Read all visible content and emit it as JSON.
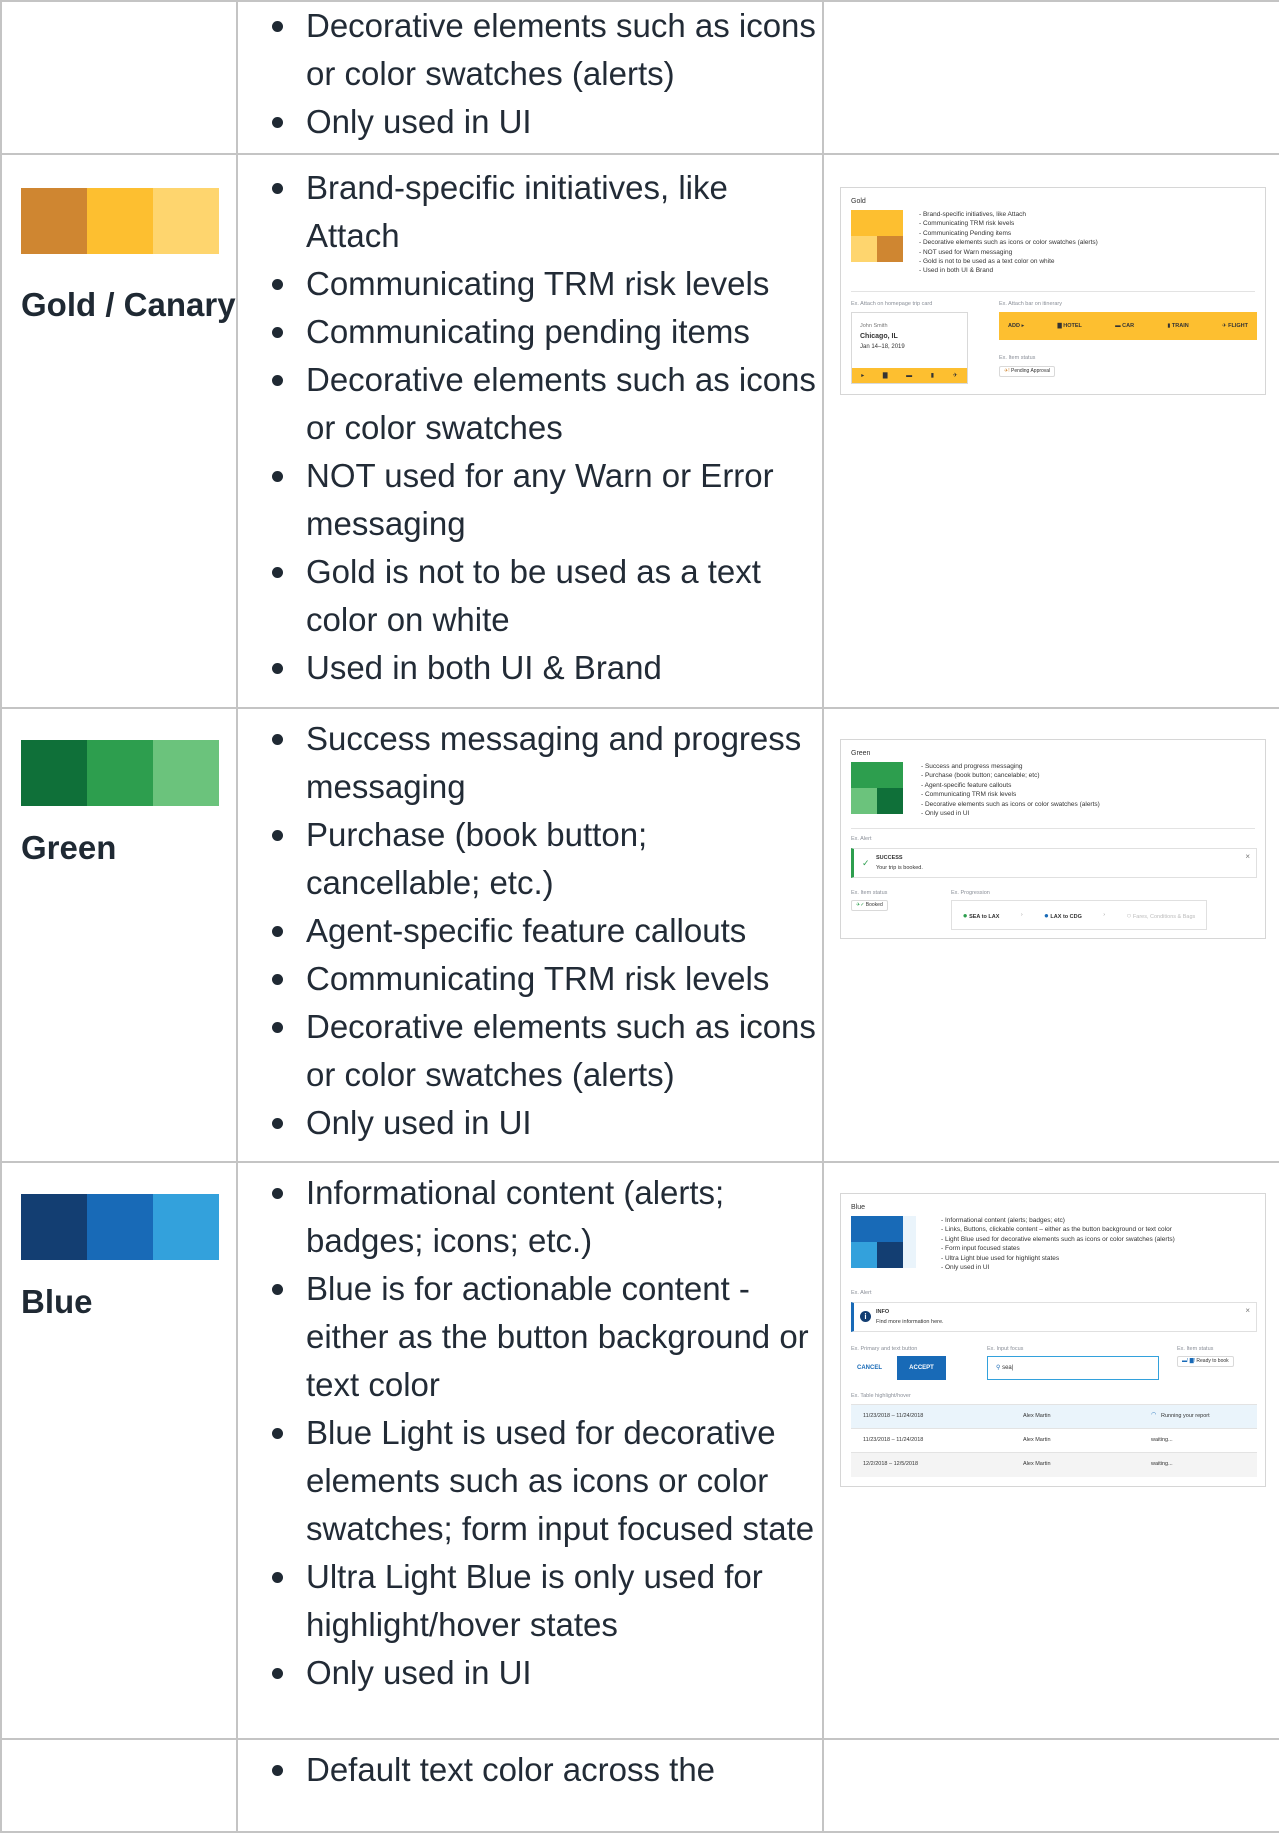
{
  "rows": {
    "partial": {
      "bullets": [
        "Decorative elements such as icons or color swatches (alerts)",
        "Only used in UI"
      ]
    },
    "gold": {
      "name": "Gold / Canary",
      "swatches": [
        "#cf8631",
        "#fdbf30",
        "#fed56e"
      ],
      "bullets": [
        "Brand-specific initiatives, like Attach",
        "Communicating TRM risk levels",
        "Communicating pending items",
        "Decorative elements such as icons or color swatches",
        "NOT used for any Warn or Error messaging",
        "Gold is not to be used as a text color on white",
        "Used in both UI & Brand"
      ]
    },
    "green": {
      "name": "Green",
      "swatches": [
        "#0f7039",
        "#2d9e4e",
        "#6bc37c"
      ],
      "bullets": [
        "Success messaging and progress messaging",
        "Purchase (book button; cancellable; etc.)",
        "Agent-specific feature callouts",
        "Communicating TRM risk levels",
        "Decorative elements such as icons or color swatches (alerts)",
        "Only used in UI"
      ]
    },
    "blue": {
      "name": "Blue",
      "swatches": [
        "#133e72",
        "#186ab7",
        "#33a1dc"
      ],
      "bullets": [
        "Informational content (alerts; badges; icons; etc.)",
        "Blue is for actionable content - either as the button background or text color",
        "Blue Light is used for decorative elements such as icons or color swatches; form input focused state",
        "Ultra Light Blue is only used for highlight/hover states",
        "Only used in UI"
      ]
    },
    "end": {
      "bullets": [
        "Default text color across the"
      ]
    }
  },
  "previews": {
    "gold": {
      "title": "Gold",
      "list": [
        "- Brand-specific initiatives, like Attach",
        "- Communicating TRM risk levels",
        "- Communicating Pending items",
        "- Decorative elements such as icons or color swatches (alerts)",
        "- NOT used for Warn messaging",
        "- Gold is not to be used as a text color on white",
        "- Used in both UI & Brand"
      ],
      "ex_card_label": "Ex. Attach on homepage trip card",
      "ex_bar_label": "Ex. Attach bar on itinerary",
      "ex_status_label": "Ex. Item status",
      "card_name": "John Smith",
      "card_city": "Chicago, IL",
      "card_dates": "Jan 14–18, 2019",
      "bar_add": "ADD",
      "bar_hotel": "HOTEL",
      "bar_car": "CAR",
      "bar_train": "TRAIN",
      "bar_flight": "FLIGHT",
      "status_text": "Pending Approval"
    },
    "green": {
      "title": "Green",
      "list": [
        "- Success and progress messaging",
        "- Purchase (book button; cancelable; etc)",
        "- Agent-specific feature callouts",
        "- Communicating TRM risk levels",
        "- Decorative elements such as icons or color swatches (alerts)",
        "- Only used in UI"
      ],
      "ex_alert_label": "Ex. Alert",
      "alert_title": "SUCCESS",
      "alert_body": "Your trip is booked.",
      "ex_status_label": "Ex. Item status",
      "status_text": "Booked",
      "ex_progress_label": "Ex. Progression",
      "step1": "SEA to LAX",
      "step2": "LAX to CDG",
      "step3": "Fares, Conditions & Bags"
    },
    "blue": {
      "title": "Blue",
      "list": [
        "- Informational content (alerts; badges; etc)",
        "- Links, Buttons, clickable content – either as the button background or text color",
        "- Light Blue used for decorative elements such as icons or color swatches (alerts)",
        "- Form input focused states",
        "- Ultra Light blue used for highlight states",
        "- Only used in UI"
      ],
      "ex_alert_label": "Ex. Alert",
      "alert_title": "INFO",
      "alert_body": "Find more information here.",
      "ex_buttons_label": "Ex. Primary and text button",
      "cancel": "CANCEL",
      "accept": "ACCEPT",
      "ex_input_label": "Ex. Input focus",
      "input_value": "sea|",
      "ex_status_label": "Ex. Item status",
      "status_text": "Ready to book",
      "ex_table_label": "Ex. Table highlight/hover",
      "table": [
        [
          "11/23/2018 – 11/24/2018",
          "Alex Martin",
          "Running your report"
        ],
        [
          "11/23/2018 – 11/24/2018",
          "Alex Martin",
          "waiting..."
        ],
        [
          "12/2/2018 – 12/5/2018",
          "Alex Martin",
          "waiting..."
        ]
      ]
    }
  }
}
